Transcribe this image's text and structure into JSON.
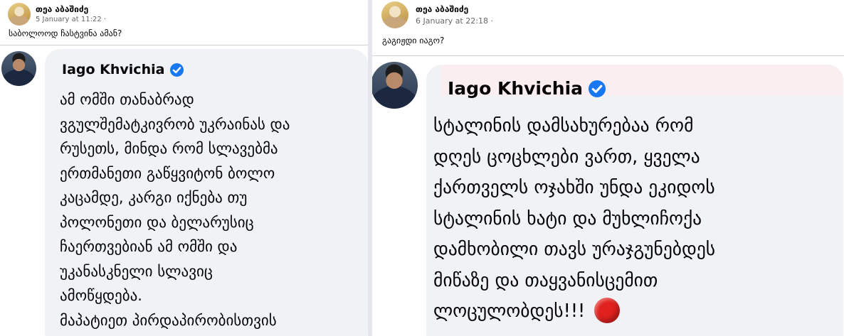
{
  "left_post": {
    "author": "თეა აბაშიძე",
    "timestamp": "5 January at 11:22",
    "audience_separator": "·",
    "caption": "საბოლოოდ ჩასტვინა ამან?",
    "quoted": {
      "name": "Iago Khvichia",
      "text": "ამ ომში თანაბრად\nვგულშემატკივრობ უკრაინას და\nრუსეთს, მინდა რომ სლავებმა\nერთმანეთი გაწყვიტონ ბოლო\nკაცამდე, კარგი იქნება თუ\nპოლონეთი და ბელარუსიც\nჩაერთვებიან ამ ომში და\nუკანასკნელი სლავიც\nამოწყდება.\nმაპატიეთ პირდაპირობისთვის"
    }
  },
  "right_post": {
    "author": "თეა აბაშიძე",
    "timestamp": "6 January at 22:18",
    "audience_separator": "·",
    "caption": "გაგიჟდი იაგო?",
    "quoted": {
      "name": "Iago Khvichia",
      "text": "სტალინის დამსახურებაა რომ\nდღეს ცოცხლები ვართ,  ყველა\nქართველს ოჯახში უნდა ეკიდოს\nსტალინის ხატი და მუხლიჩოქა\nდამხობილი თავს ურაჯგუნებდეს\nმიწაზე და თაყვანისცემით\nლოცულობდეს!!!"
    }
  },
  "icons": {
    "verified": "verified-badge-icon",
    "emoji": "red-circle-emoji"
  },
  "colors": {
    "verified": "#1877f2",
    "bubble": "#f0f2f5",
    "meta_text": "#65676b",
    "emoji_red": "#e0211d"
  }
}
